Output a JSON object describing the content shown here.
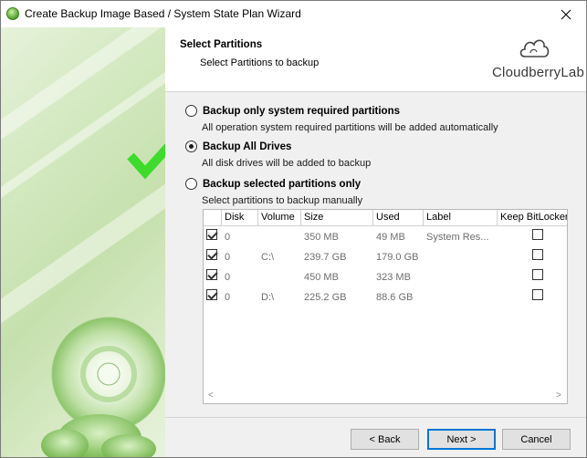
{
  "window": {
    "title": "Create Backup Image Based / System State Plan Wizard",
    "close_icon": "close-icon"
  },
  "header": {
    "title": "Select Partitions",
    "subtitle": "Select Partitions to backup",
    "logo_text": "CloudberryLab"
  },
  "options": [
    {
      "label": "Backup only system required partitions",
      "description": "All operation system required partitions will be added automatically",
      "selected": false
    },
    {
      "label": "Backup All Drives",
      "description": "All disk drives will be added to backup",
      "selected": true
    },
    {
      "label": "Backup selected partitions only",
      "description": "Select partitions to backup manually",
      "selected": false
    }
  ],
  "table": {
    "columns": [
      "",
      "Disk",
      "Volume",
      "Size",
      "Used",
      "Label",
      "Keep BitLocker"
    ],
    "rows": [
      {
        "checked": true,
        "disk": "0",
        "volume": "",
        "size": "350 MB",
        "used": "49 MB",
        "label": "System Res...",
        "keep_bitlocker": false
      },
      {
        "checked": true,
        "disk": "0",
        "volume": "C:\\",
        "size": "239.7 GB",
        "used": "179.0 GB",
        "label": "",
        "keep_bitlocker": false
      },
      {
        "checked": true,
        "disk": "0",
        "volume": "",
        "size": "450 MB",
        "used": "323 MB",
        "label": "",
        "keep_bitlocker": false
      },
      {
        "checked": true,
        "disk": "0",
        "volume": "D:\\",
        "size": "225.2 GB",
        "used": "88.6 GB",
        "label": "",
        "keep_bitlocker": false
      }
    ],
    "scroll_left": "<",
    "scroll_right": ">"
  },
  "footer": {
    "back_label": "< Back",
    "next_label": "Next >",
    "cancel_label": "Cancel"
  },
  "colors": {
    "accent": "#0078d7",
    "checkmark": "#3ddc2c"
  }
}
